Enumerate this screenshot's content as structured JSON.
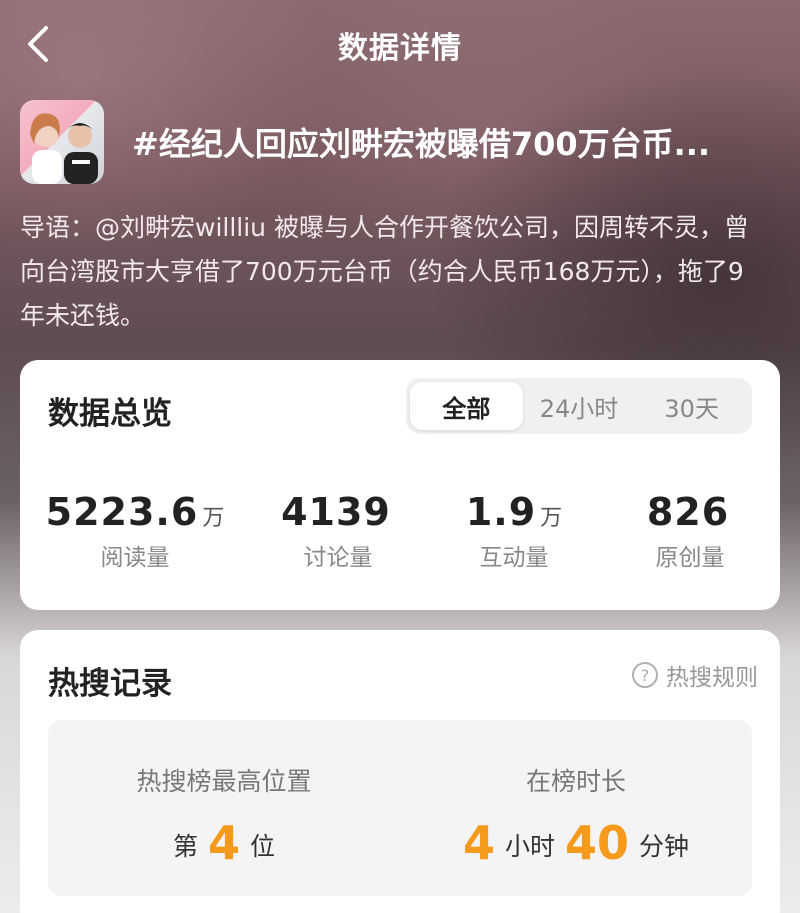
{
  "header": {
    "title": "数据详情",
    "back_icon": "chevron-left-icon"
  },
  "topic": {
    "title": "#经纪人回应刘畊宏被曝借700万台币...",
    "intro": "导语：@刘畊宏willliu 被曝与人合作开餐饮公司，因周转不灵，曾向台湾股市大亨借了700万元台币（约合人民币168万元），拖了9年未还钱。"
  },
  "overview": {
    "title": "数据总览",
    "tabs": [
      "全部",
      "24小时",
      "30天"
    ],
    "active_tab": "全部",
    "stats": [
      {
        "value": "5223.6",
        "unit": "万",
        "label": "阅读量"
      },
      {
        "value": "4139",
        "unit": "",
        "label": "讨论量"
      },
      {
        "value": "1.9",
        "unit": "万",
        "label": "互动量"
      },
      {
        "value": "826",
        "unit": "",
        "label": "原创量"
      }
    ]
  },
  "hot_search": {
    "title": "热搜记录",
    "rules_label": "热搜规则",
    "peak": {
      "label": "热搜榜最高位置",
      "prefix": "第",
      "value": "4",
      "suffix": "位"
    },
    "duration": {
      "label": "在榜时长",
      "hours": "4",
      "hours_unit": "小时",
      "minutes": "40",
      "minutes_unit": "分钟"
    }
  },
  "colors": {
    "accent_orange": "#f59a1b"
  }
}
